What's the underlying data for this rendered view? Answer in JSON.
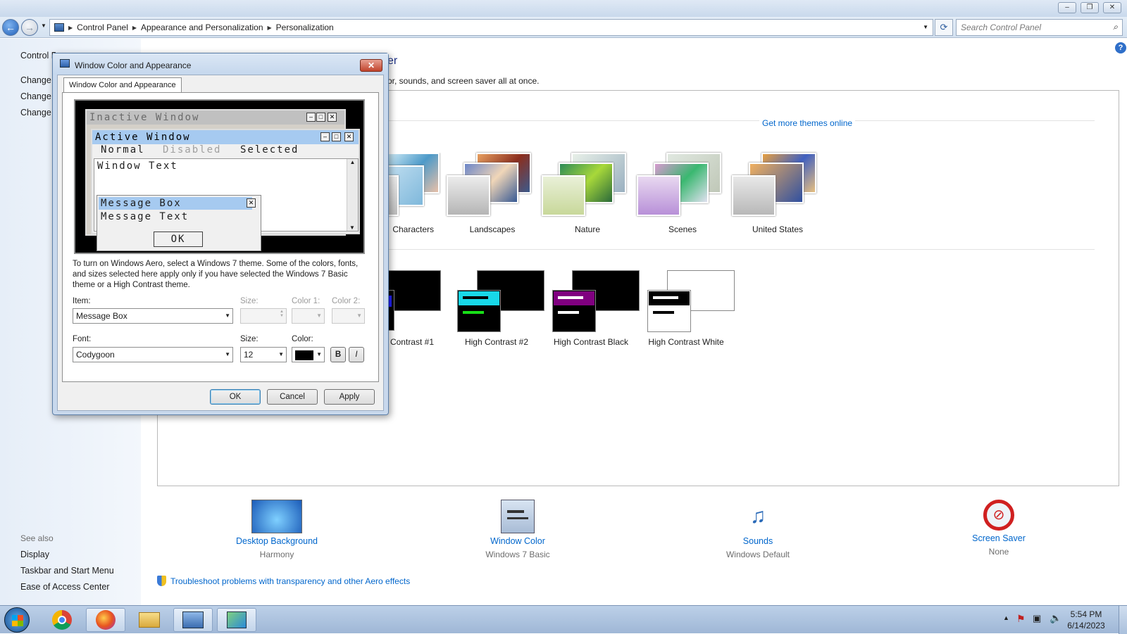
{
  "window": {
    "minimize": "–",
    "restore": "❐",
    "close": "✕"
  },
  "address": {
    "crumbs": [
      "Control Panel",
      "Appearance and Personalization",
      "Personalization"
    ],
    "search_placeholder": "Search Control Panel"
  },
  "leftpane": {
    "home": "Control Panel Home",
    "links": [
      "Change desktop icons",
      "Change mouse pointers",
      "Change your account picture"
    ],
    "see_also_title": "See also",
    "see_also": [
      "Display",
      "Taskbar and Start Menu",
      "Ease of Access Center"
    ]
  },
  "content": {
    "heading_tail": "er",
    "desc_tail": "or, sounds, and screen saver all at once.",
    "get_more_themes": "Get more themes online",
    "themes": [
      "Characters",
      "Landscapes",
      "Nature",
      "Scenes",
      "United States"
    ],
    "basic_themes": [
      "High Contrast #1",
      "High Contrast #2",
      "High Contrast Black",
      "High Contrast White"
    ],
    "bottom": [
      {
        "label": "Desktop Background",
        "sub": "Harmony"
      },
      {
        "label": "Window Color",
        "sub": "Windows 7 Basic"
      },
      {
        "label": "Sounds",
        "sub": "Windows Default"
      },
      {
        "label": "Screen Saver",
        "sub": "None"
      }
    ],
    "troubleshoot": "Troubleshoot problems with transparency and other Aero effects"
  },
  "dialog": {
    "title": "Window Color and Appearance",
    "tab": "Window Color and Appearance",
    "preview": {
      "inactive": "Inactive Window",
      "active": "Active Window",
      "normal": "Normal",
      "disabled": "Disabled",
      "selected": "Selected",
      "window_text": "Window Text",
      "msgbox": "Message Box",
      "msgtext": "Message Text",
      "ok": "OK"
    },
    "info": "To turn on Windows Aero, select a Windows 7 theme.  Some of the colors, fonts, and sizes selected here apply only if you have selected the Windows 7 Basic theme or a High Contrast theme.",
    "item_label": "Item:",
    "item_value": "Message Box",
    "size_label": "Size:",
    "color1_label": "Color 1:",
    "color2_label": "Color 2:",
    "font_label": "Font:",
    "font_value": "Codygoon",
    "font_size_label": "Size:",
    "font_size_value": "12",
    "color_label": "Color:",
    "bold": "B",
    "italic": "I",
    "ok": "OK",
    "cancel": "Cancel",
    "apply": "Apply"
  },
  "taskbar": {
    "time": "5:54 PM",
    "date": "6/14/2023"
  },
  "colors": {
    "link": "#0066cc",
    "titlebar_active": "#a6caf0",
    "font_color": "#000000"
  }
}
